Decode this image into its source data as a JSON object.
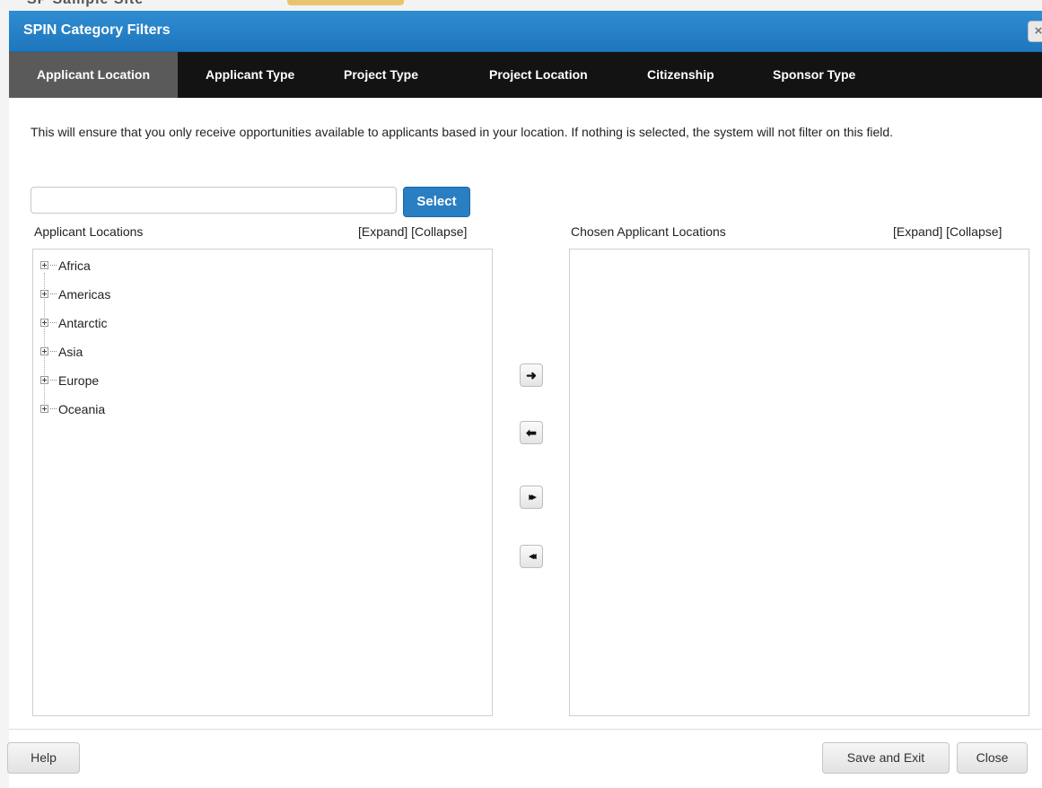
{
  "background_page": {
    "heading": "SP Sample Site"
  },
  "dialog": {
    "title": "SPIN Category Filters",
    "close_glyph": "×"
  },
  "tabs": [
    {
      "label": "Applicant Location",
      "active": true
    },
    {
      "label": "Applicant Type",
      "active": false
    },
    {
      "label": "Project Type",
      "active": false
    },
    {
      "label": "Project Location",
      "active": false
    },
    {
      "label": "Citizenship",
      "active": false
    },
    {
      "label": "Sponsor Type",
      "active": false
    }
  ],
  "description": "This will ensure that you only receive opportunities available to applicants based in your location. If nothing is selected, the system will not filter on this field.",
  "search": {
    "value": "",
    "placeholder": "",
    "button_label": "Select"
  },
  "left_panel": {
    "label": "Applicant Locations",
    "expand_label": "[Expand]",
    "collapse_label": "[Collapse]",
    "items": [
      {
        "label": "Africa"
      },
      {
        "label": "Americas"
      },
      {
        "label": "Antarctic"
      },
      {
        "label": "Asia"
      },
      {
        "label": "Europe"
      },
      {
        "label": "Oceania"
      }
    ]
  },
  "right_panel": {
    "label": "Chosen Applicant Locations",
    "expand_label": "[Expand]",
    "collapse_label": "[Collapse]",
    "items": []
  },
  "transfer_buttons": [
    {
      "name": "move-right-button",
      "icon": "arrow-right-icon",
      "glyph": "➜"
    },
    {
      "name": "move-left-button",
      "icon": "arrow-left-icon",
      "glyph": "⬅"
    },
    {
      "name": "move-all-right-button",
      "icon": "double-arrow-right-icon",
      "glyph": "▸▸"
    },
    {
      "name": "move-all-left-button",
      "icon": "double-arrow-left-icon",
      "glyph": "◂◂"
    }
  ],
  "footer": {
    "help_label": "Help",
    "save_label": "Save and Exit",
    "close_label": "Close"
  },
  "colors": {
    "titlebar": "#1f76bd",
    "tabbar": "#131313",
    "active_tab": "#5a5a5a",
    "primary_button": "#2a7ec2"
  }
}
